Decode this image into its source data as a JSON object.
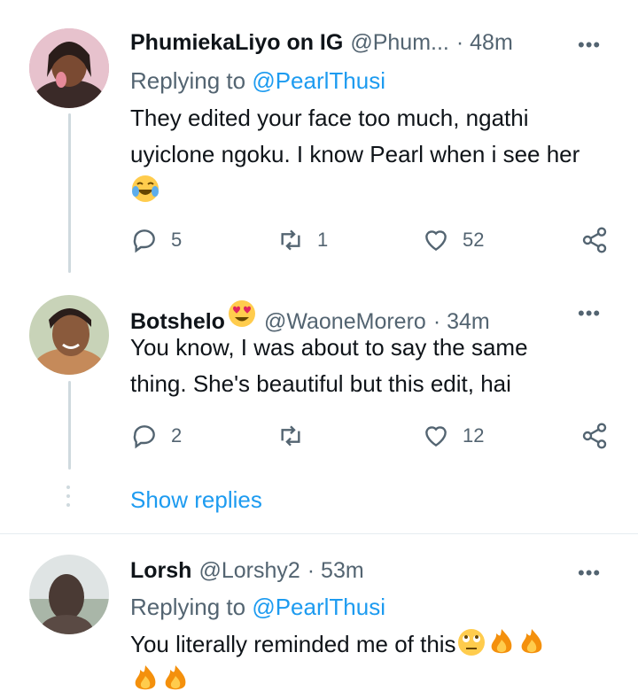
{
  "tweets": [
    {
      "display_name": "PhumiekaLiyo on IG",
      "handle": "@Phum...",
      "time": "· 48m",
      "replying_prefix": "Replying to",
      "replying_to": "@PearlThusi",
      "text_line1": "They edited your face too much, ngathi",
      "text_line2": "uyiclone ngoku. I know Pearl when i see her",
      "emoji": "joy-emoji",
      "replies": "5",
      "retweets": "1",
      "likes": "52"
    },
    {
      "display_name": "Botshelo",
      "name_emoji": "heart-eyes-emoji",
      "handle": "@WaoneMorero",
      "time": "· 34m",
      "text_line1": "You know, I was about to say the same",
      "text_line2": "thing.  She's beautiful but this edit, hai",
      "replies": "2",
      "retweets": "",
      "likes": "12"
    },
    {
      "display_name": "Lorsh",
      "handle": "@Lorshy2",
      "time": "· 53m",
      "replying_prefix": "Replying to",
      "replying_to": "@PearlThusi",
      "text_line1": "You literally reminded me of this",
      "emojis": [
        "rolling-eyes-emoji",
        "fire-emoji",
        "fire-emoji",
        "fire-emoji",
        "fire-emoji"
      ]
    }
  ],
  "show_replies": "Show replies",
  "more_icon": "•••",
  "colors": {
    "accent": "#1d9bf0",
    "muted": "#536471",
    "text": "#0f1419",
    "line": "#cfd9de"
  }
}
